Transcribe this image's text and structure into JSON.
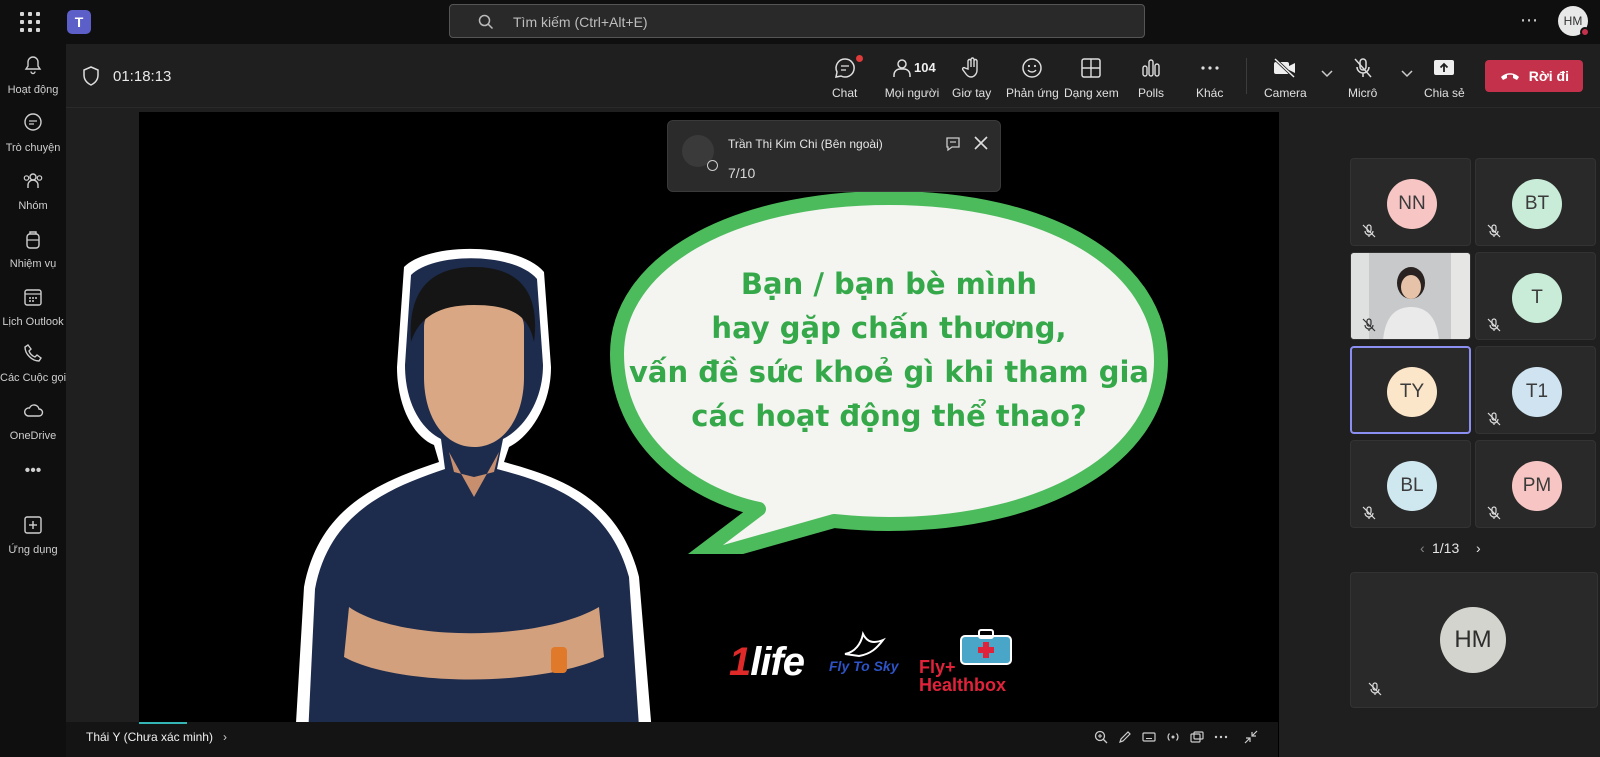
{
  "top": {
    "search_placeholder": "Tìm kiếm (Ctrl+Alt+E)",
    "avatar": "HM"
  },
  "rail": [
    {
      "label": "Hoạt động"
    },
    {
      "label": "Trò chuyện"
    },
    {
      "label": "Nhóm"
    },
    {
      "label": "Nhiệm vụ"
    },
    {
      "label": "Lịch Outlook"
    },
    {
      "label": "Các Cuộc gọi"
    },
    {
      "label": "OneDrive"
    },
    {
      "label": "Ứng dụng"
    }
  ],
  "meeting": {
    "timer": "01:18:13",
    "controls": {
      "chat": "Chat",
      "people": "Mọi người",
      "people_count": "104",
      "raise": "Giơ tay",
      "react": "Phản ứng",
      "view": "Dạng xem",
      "polls": "Polls",
      "more": "Khác",
      "camera": "Camera",
      "mic": "Micrô",
      "share": "Chia sẻ",
      "leave": "Rời đi"
    }
  },
  "slide": {
    "lines": [
      "Bạn / bạn bè mình",
      "hay gặp chấn thương,",
      "vấn đề sức khoẻ gì khi tham gia",
      "các hoạt động thể thao?"
    ],
    "logos": {
      "life_prefix": "1",
      "life": "life",
      "fly": "Fly To Sky",
      "healthbox_1": "Fly+",
      "healthbox_2": "Healthbox"
    }
  },
  "toast": {
    "name": "Trần Thị Kim Chi (Bên ngoài)",
    "message": "7/10"
  },
  "presenter_tag": "Thái Y (Chưa xác minh)",
  "participants": [
    {
      "initials": "NN",
      "color": "#f7c6c4"
    },
    {
      "initials": "BT",
      "color": "#c9ecd8"
    },
    {
      "initials": "",
      "color": "#9aa0a6"
    },
    {
      "initials": "T",
      "color": "#c9ecd8"
    },
    {
      "initials": "TY",
      "color": "#fbe6c9"
    },
    {
      "initials": "T1",
      "color": "#cfe4f0"
    },
    {
      "initials": "BL",
      "color": "#cfe8ef"
    },
    {
      "initials": "PM",
      "color": "#f7c6c4"
    }
  ],
  "pager": "1/13",
  "self": {
    "initials": "HM"
  }
}
